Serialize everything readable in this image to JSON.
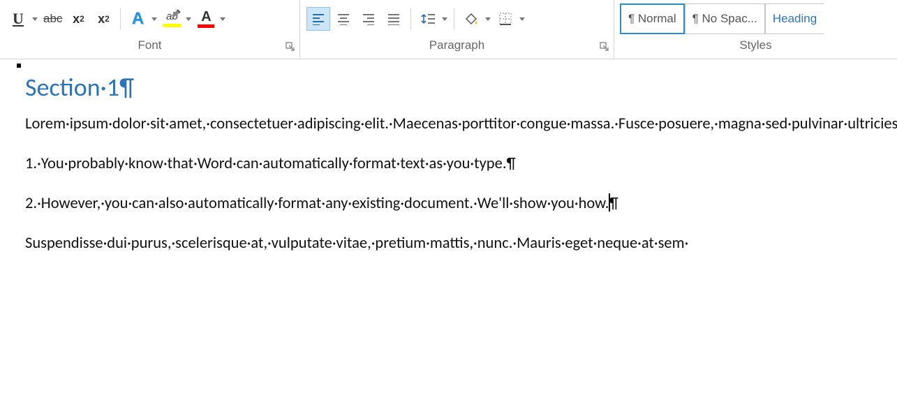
{
  "ribbon": {
    "font": {
      "label": "Font",
      "underline": "U",
      "strike": "abc",
      "sub": "x",
      "sub_n": "2",
      "sup": "x",
      "sup_n": "2",
      "effects": "A",
      "highlight": "ab",
      "color": "A"
    },
    "paragraph": {
      "label": "Paragraph"
    },
    "styles": {
      "label": "Styles",
      "items": [
        "¶ Normal",
        "¶ No Spac...",
        "Heading"
      ]
    }
  },
  "document": {
    "heading": "Section·1¶",
    "para1": "Lorem·ipsum·dolor·sit·amet,·consectetuer·adipiscing·elit.·Maecenas·porttitor·congue·massa.·Fusce·posuere,·magna·sed·pulvinar·ultricies,·purus·lectus·malesuada·libero,·sit·amet·commodo·magna·eros·quis·urna.·Nunc·viverra·imperdiet·enim,·http://www.howtogeek.com.·Fusce·est.·Vivamus·a·tellus.·Pellentesque·habitant·morbi·tristique·senectus·et·netus·et·malesuada·fames·ac·turpis·egestas.·Proin·pharetra·nonummy·pede,·lori@howtogeek.com.·Mauris·et·orci.·Aenean·nec·lorem.·In·porttitor.·Donec·laoreet·nonummy·augue.¶",
    "para2": "1.·You·probably·know·that·Word·can·automatically·format·text·as·you·type.¶",
    "para3": "2.·However,·you·can·also·automatically·format·any·existing·document.·We'll·show·you·how.¶",
    "para4": "Suspendisse·dui·purus,·scelerisque·at,·vulputate·vitae,·pretium·mattis,·nunc.·Mauris·eget·neque·at·sem·"
  }
}
